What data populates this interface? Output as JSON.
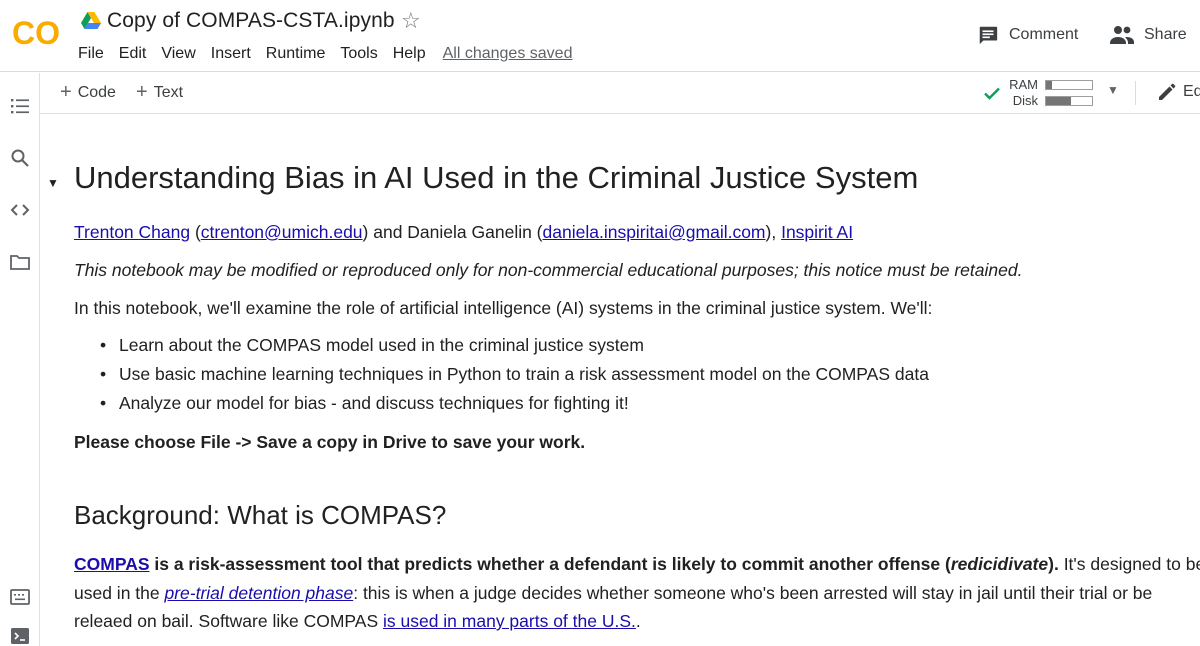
{
  "header": {
    "logo_text": "CO",
    "title": "Copy of COMPAS-CSTA.ipynb",
    "menu": [
      "File",
      "Edit",
      "View",
      "Insert",
      "Runtime",
      "Tools",
      "Help"
    ],
    "save_status": "All changes saved",
    "comment_label": "Comment",
    "share_label": "Share"
  },
  "toolbar": {
    "add_code_label": "Code",
    "add_text_label": "Text",
    "ram_label": "RAM",
    "disk_label": "Disk",
    "ram_usage": 0.12,
    "disk_usage": 0.55,
    "edit_label": "Ed"
  },
  "notebook": {
    "heading": "Understanding Bias in AI Used in the Criminal Justice System",
    "authors": {
      "author1": "Trenton Chang",
      "open1": " (",
      "email1": "ctrenton@umich.edu",
      "mid": ") and Daniela Ganelin (",
      "email2": "daniela.inspiritai@gmail.com",
      "close": "), ",
      "org": "Inspirit AI"
    },
    "notice": "This notebook may be modified or reproduced only for non-commercial educational purposes; this notice must be retained.",
    "intro": "In this notebook, we'll examine the role of artificial intelligence (AI) systems in the criminal justice system. We'll:",
    "bullets": [
      "Learn about the COMPAS model used in the criminal justice system",
      "Use basic machine learning techniques in Python to train a risk assessment model on the COMPAS data",
      "Analyze our model for bias - and discuss techniques for fighting it!"
    ],
    "save_instruction": "Please choose File -> Save a copy in Drive to save your work.",
    "background_heading": "Background: What is COMPAS?",
    "bg": {
      "compas_link": "COMPAS",
      "bold1": " is a risk-assessment tool that predicts whether a defendant is likely to commit another offense (",
      "bold_italic": "redicidivate",
      "bold2": ").",
      "line1_tail": " It's designed to be",
      "line2_pre": "used in the ",
      "pretrial_link": "pre-trial detention phase",
      "line2_post": ": this is when a judge decides whether someone who's been arrested will stay in jail until their trial or be",
      "line3_pre": "releaed on bail. Software like COMPAS ",
      "used_link": "is used in many parts of the U.S.",
      "line3_post": "."
    }
  },
  "colors": {
    "logo_orange": "#F9AB00",
    "logo_orange_dark": "#E8710A",
    "link": "#1a0dab",
    "check_green": "#0F9D58"
  }
}
